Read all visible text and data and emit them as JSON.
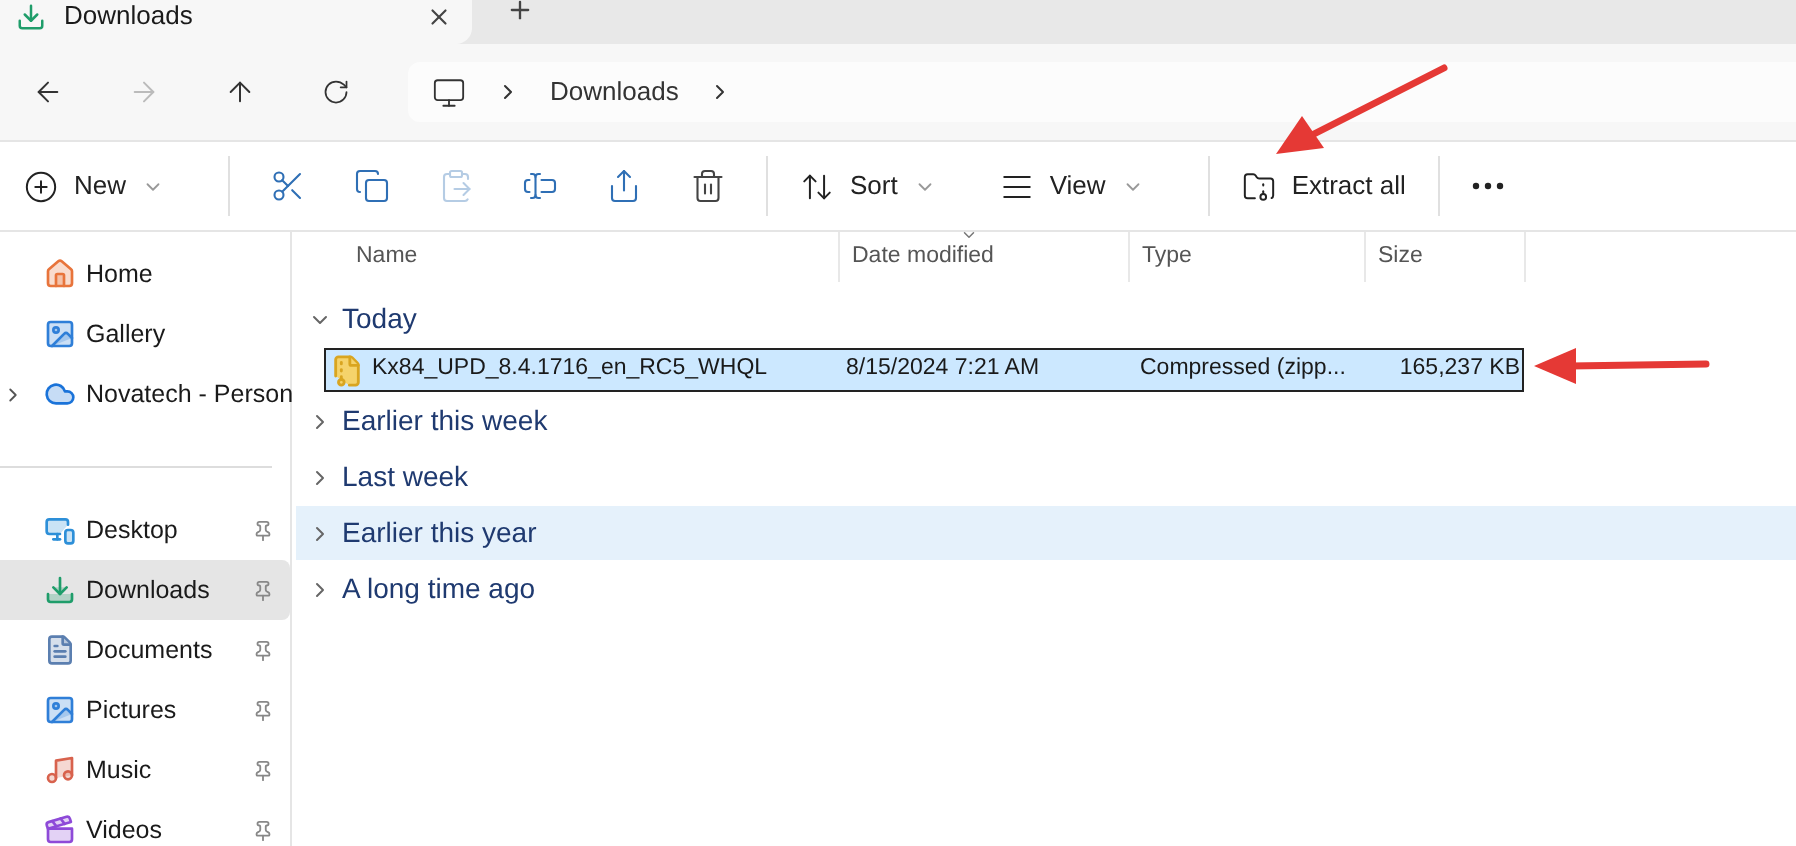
{
  "tabs": [
    {
      "label": "Downloads",
      "selected": true
    }
  ],
  "navigation": {
    "back_disabled": false,
    "forward_disabled": true
  },
  "breadcrumb": [
    "Downloads"
  ],
  "toolbar": [
    {
      "kind": "menu",
      "label": "New"
    },
    {
      "kind": "separator"
    },
    {
      "kind": "icon",
      "disabled": false
    },
    {
      "kind": "icon",
      "disabled": false
    },
    {
      "kind": "icon",
      "disabled": true
    },
    {
      "kind": "icon",
      "disabled": false
    },
    {
      "kind": "icon",
      "disabled": false
    },
    {
      "kind": "icon",
      "disabled": false
    },
    {
      "kind": "separator"
    },
    {
      "kind": "menu",
      "label": "Sort"
    },
    {
      "kind": "menu",
      "label": "View"
    },
    {
      "kind": "separator"
    },
    {
      "kind": "button",
      "label": "Extract all"
    },
    {
      "kind": "separator"
    },
    {
      "kind": "more"
    }
  ],
  "sidebar": {
    "sections": [
      [
        {
          "label": "Home",
          "kind": "link",
          "selected": false
        },
        {
          "label": "Gallery",
          "kind": "link",
          "selected": false
        },
        {
          "label": "Novatech - Person",
          "kind": "tree",
          "expanded": false,
          "selected": false
        }
      ],
      [
        {
          "label": "Desktop",
          "kind": "pinned",
          "selected": false
        },
        {
          "label": "Downloads",
          "kind": "pinned",
          "selected": true
        },
        {
          "label": "Documents",
          "kind": "pinned",
          "selected": false
        },
        {
          "label": "Pictures",
          "kind": "pinned",
          "selected": false
        },
        {
          "label": "Music",
          "kind": "pinned",
          "selected": false
        },
        {
          "label": "Videos",
          "kind": "pinned",
          "selected": false
        }
      ]
    ]
  },
  "table": {
    "columns": [
      {
        "label": "Name",
        "sorted": false
      },
      {
        "label": "Date modified",
        "sorted": true
      },
      {
        "label": "Type",
        "sorted": false
      },
      {
        "label": "Size",
        "sorted": false
      }
    ],
    "groups": [
      {
        "label": "Today",
        "expanded": true,
        "hovered": false,
        "rows": [
          {
            "name": "Kx84_UPD_8.4.1716_en_RC5_WHQL",
            "date": "8/15/2024 7:21 AM",
            "type": "Compressed (zipp...",
            "size": "165,237 KB",
            "selected": true
          }
        ]
      },
      {
        "label": "Earlier this week",
        "expanded": false,
        "hovered": false
      },
      {
        "label": "Last week",
        "expanded": false,
        "hovered": false
      },
      {
        "label": "Earlier this year",
        "expanded": false,
        "hovered": true
      },
      {
        "label": "A long time ago",
        "expanded": false,
        "hovered": false
      }
    ]
  }
}
